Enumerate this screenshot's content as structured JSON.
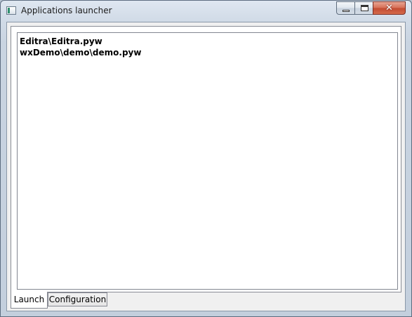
{
  "window": {
    "title": "Applications launcher",
    "controls": {
      "minimize": "minimize",
      "maximize": "maximize",
      "close": "✕"
    }
  },
  "tabs": [
    {
      "label": "Launch",
      "selected": true
    },
    {
      "label": "Configuration",
      "selected": false
    }
  ],
  "launch_list": {
    "items": [
      "Editra\\Editra.pyw",
      "wxDemo\\demo\\demo.pyw"
    ]
  },
  "icons": {
    "app": "app-window-icon",
    "minimize": "minimize-icon",
    "maximize": "maximize-icon",
    "close": "close-icon"
  },
  "colors": {
    "close_button": "#c24b32",
    "frame": "#c9d4e1"
  }
}
